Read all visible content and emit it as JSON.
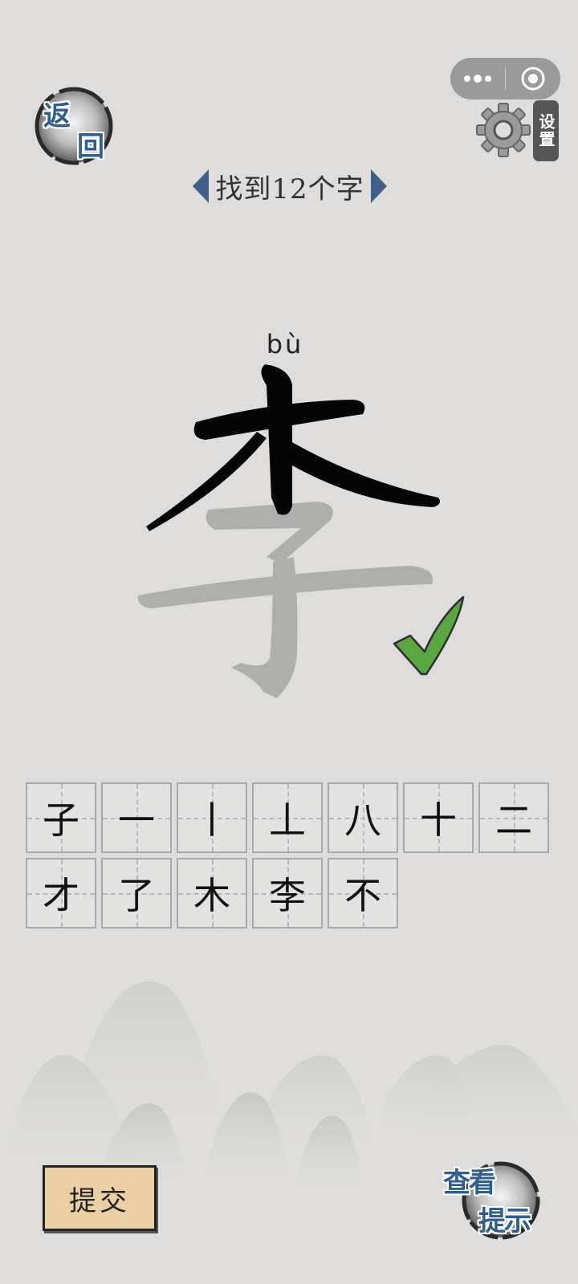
{
  "header": {
    "back_label_top": "返",
    "back_label_bottom": "回",
    "settings_label": "设置",
    "level_title": "找到12个字"
  },
  "capsule": {
    "more_icon": "more-dots-icon",
    "close_icon": "target-close-icon"
  },
  "puzzle": {
    "pinyin": "bù",
    "character": "李",
    "status": "correct"
  },
  "found_chars": [
    "子",
    "一",
    "丨",
    "丄",
    "八",
    "十",
    "二",
    "才",
    "了",
    "木",
    "李",
    "不"
  ],
  "footer": {
    "submit_label": "提交",
    "hint_label_top": "查看",
    "hint_label_bottom": "提示"
  },
  "colors": {
    "background": "#dedddb",
    "accent_blue": "#2f5f8a",
    "check_green": "#5aa640",
    "submit_bg": "#e9cfa3"
  }
}
